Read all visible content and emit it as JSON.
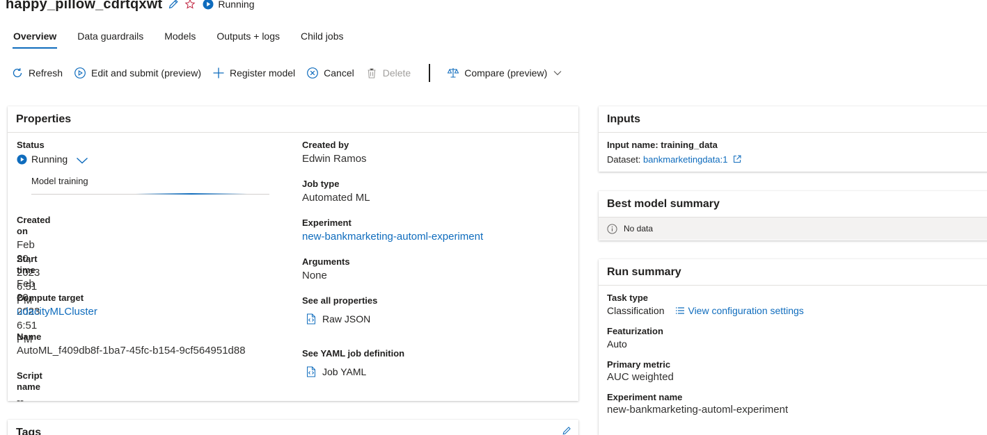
{
  "header": {
    "title": "happy_pillow_cdrtqxwt",
    "status": "Running"
  },
  "tabs": [
    {
      "label": "Overview"
    },
    {
      "label": "Data guardrails"
    },
    {
      "label": "Models"
    },
    {
      "label": "Outputs + logs"
    },
    {
      "label": "Child jobs"
    }
  ],
  "toolbar": {
    "refresh": "Refresh",
    "edit_submit": "Edit and submit (preview)",
    "register_model": "Register model",
    "cancel": "Cancel",
    "delete": "Delete",
    "compare": "Compare (preview)"
  },
  "properties": {
    "title": "Properties",
    "status_label": "Status",
    "status_value": "Running",
    "progress_label": "Model training",
    "created_on_label": "Created on",
    "created_on_value": "Feb 20, 2023 6:51 PM",
    "start_time_label": "Start time",
    "start_time_value": "Feb 20, 2023 6:51 PM",
    "compute_target_label": "Compute target",
    "compute_target_value": "udacityMLCluster",
    "name_label": "Name",
    "name_value": "AutoML_f409db8f-1ba7-45fc-b154-9cf564951d88",
    "script_name_label": "Script name",
    "script_name_value": "--",
    "created_by_label": "Created by",
    "created_by_value": "Edwin Ramos",
    "job_type_label": "Job type",
    "job_type_value": "Automated ML",
    "experiment_label": "Experiment",
    "experiment_value": "new-bankmarketing-automl-experiment",
    "arguments_label": "Arguments",
    "arguments_value": "None",
    "all_props_label": "See all properties",
    "raw_json": "Raw JSON",
    "yaml_label": "See YAML job definition",
    "job_yaml": "Job YAML"
  },
  "inputs": {
    "title": "Inputs",
    "input_name": "Input name: training_data",
    "dataset_prefix": "Dataset:",
    "dataset_link": "bankmarketingdata:1"
  },
  "best_model": {
    "title": "Best model summary",
    "no_data": "No data"
  },
  "run_summary": {
    "title": "Run summary",
    "task_type_label": "Task type",
    "task_type_value": "Classification",
    "view_config": "View configuration settings",
    "featurization_label": "Featurization",
    "featurization_value": "Auto",
    "primary_metric_label": "Primary metric",
    "primary_metric_value": "AUC weighted",
    "experiment_name_label": "Experiment name",
    "experiment_name_value": "new-bankmarketing-automl-experiment"
  },
  "tags": {
    "title": "Tags"
  },
  "colors": {
    "accent": "#0f6cbd",
    "favorite": "#c4314b",
    "disabled": "#a19f9d"
  }
}
